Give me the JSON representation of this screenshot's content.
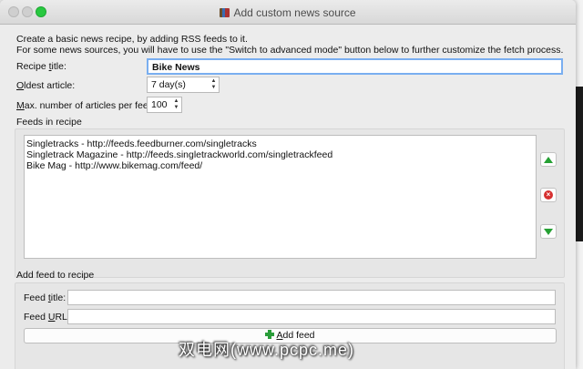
{
  "window": {
    "title": "Add custom news source"
  },
  "intro": {
    "line1": "Create a basic news recipe, by adding RSS feeds to it.",
    "line2": "For some news sources, you will have to use the \"Switch to advanced mode\" button below to further customize the fetch process."
  },
  "form": {
    "recipe_title_label_pre": "Recipe ",
    "recipe_title_label_u": "t",
    "recipe_title_label_post": "itle:",
    "recipe_title_value": "Bike News",
    "oldest_label_u": "O",
    "oldest_label_post": "ldest article:",
    "oldest_value": "7 day(s)",
    "max_label_u": "M",
    "max_label_post": "ax. number of articles per feed:",
    "max_value": "100"
  },
  "feeds": {
    "group_label": "Feeds in recipe",
    "items": [
      "Singletracks - http://feeds.feedburner.com/singletracks",
      "Singletrack Magazine - http://feeds.singletrackworld.com/singletrackfeed",
      "Bike Mag - http://www.bikemag.com/feed/"
    ]
  },
  "add_feed": {
    "group_label": "Add feed to recipe",
    "title_label_pre": "Feed ",
    "title_label_u": "t",
    "title_label_post": "itle:",
    "url_label_pre": "Feed ",
    "url_label_u": "U",
    "url_label_post": "RL:",
    "title_value": "",
    "url_value": "",
    "button_label_u": "A",
    "button_label_post": "dd feed"
  },
  "watermark": "双电网(www.pcpc.me)",
  "colors": {
    "accent_focus": "#79aef0",
    "green": "#25a033",
    "red": "#d63030"
  }
}
